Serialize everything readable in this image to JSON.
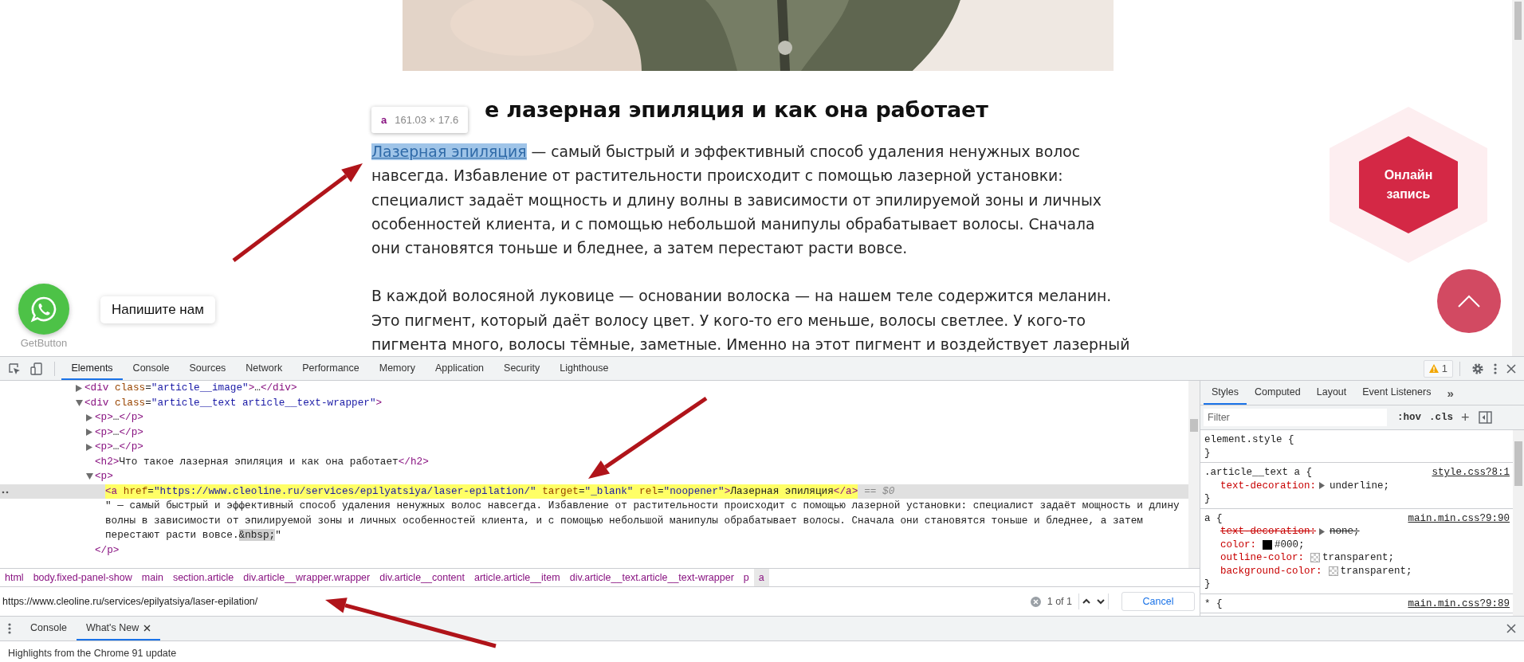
{
  "page": {
    "heading": "е лазерная эпиляция и как она работает",
    "inspect_tooltip": {
      "tag": "a",
      "size": "161.03 × 17.6"
    },
    "paragraphs": [
      {
        "link": "Лазерная эпиляция",
        "link_highlighted": true,
        "lines": [
          " — самый быстрый и эффективный способ удаления ненужных волос",
          "навсегда. Избавление от растительности происходит с помощью лазерной установки:",
          "специалист задаёт мощность и длину волны в зависимости от эпилируемой зоны и личных",
          "особенностей клиента, и с помощью небольшой манипулы обрабатывает волосы. Сначала",
          "они становятся тоньше и бледнее, а затем перестают расти вовсе."
        ]
      },
      {
        "lines": [
          "В каждой волосяной луковице — основании волоска — на нашем теле содержится меланин.",
          "Это пигмент, который даёт волосу цвет. У кого-то его меньше, волосы светлее. У кого-то",
          "пигмента много, волосы тёмные, заметные. Именно на этот пигмент и воздействует лазерный"
        ]
      }
    ],
    "chat_widget": {
      "caption": "GetButton",
      "bubble": "Напишите нам"
    },
    "booking_button": "Онлайн запись"
  },
  "devtools": {
    "tabs": [
      {
        "label": "Elements",
        "selected": true
      },
      {
        "label": "Console",
        "selected": false
      },
      {
        "label": "Sources",
        "selected": false
      },
      {
        "label": "Network",
        "selected": false
      },
      {
        "label": "Performance",
        "selected": false
      },
      {
        "label": "Memory",
        "selected": false
      },
      {
        "label": "Application",
        "selected": false
      },
      {
        "label": "Security",
        "selected": false
      },
      {
        "label": "Lighthouse",
        "selected": false
      }
    ],
    "issues_count": "1",
    "dom_tree": [
      {
        "kind": "collapsed",
        "markup": "<div class=\"article__image\">…</div>",
        "selected": false
      },
      {
        "kind": "expanded",
        "markup": "<div class=\"article__text article__text-wrapper\">",
        "selected": false,
        "children": [
          {
            "kind": "collapsed",
            "markup": "<p>…</p>",
            "selected": false
          },
          {
            "kind": "collapsed",
            "markup": "<p>…</p>",
            "selected": false
          },
          {
            "kind": "collapsed",
            "markup": "<p>…</p>",
            "selected": false
          },
          {
            "kind": "leaf",
            "markup": "<h2>Что такое лазерная эпиляция и как она работает</h2>",
            "selected": false
          },
          {
            "kind": "expanded",
            "markup": "<p>",
            "selected": false,
            "closing": "</p>",
            "children": [
              {
                "kind": "leaf",
                "markup": "<a href=\"https://www.cleoline.ru/services/epilyatsiya/laser-epilation/\" target=\"_blank\" rel=\"noopener\">Лазерная эпиляция</a>",
                "selected": true,
                "reference": "== $0"
              },
              {
                "kind": "text",
                "markup": "\" — самый быстрый и эффективный способ удаления ненужных волос навсегда. Избавление от растительности происходит с помощью лазерной установки: специалист задаёт мощность и длину волны в зависимости от эпилируемой зоны и личных особенностей клиента, и с помощью небольшой манипулы обрабатывает волосы. Сначала они становятся тоньше и бледнее, а затем перестают расти вовсе.&nbsp;\"",
                "selected": false
              }
            ]
          }
        ]
      }
    ],
    "breadcrumbs": [
      {
        "label": "html",
        "selected": false
      },
      {
        "label": "body.fixed-panel-show",
        "selected": false
      },
      {
        "label": "main",
        "selected": false
      },
      {
        "label": "section.article",
        "selected": false
      },
      {
        "label": "div.article__wrapper.wrapper",
        "selected": false
      },
      {
        "label": "div.article__content",
        "selected": false
      },
      {
        "label": "article.article__item",
        "selected": false
      },
      {
        "label": "div.article__text.article__text-wrapper",
        "selected": false
      },
      {
        "label": "p",
        "selected": false
      },
      {
        "label": "a",
        "selected": true
      }
    ],
    "search": {
      "value": "https://www.cleoline.ru/services/epilyatsiya/laser-epilation/",
      "match_count": "1 of 1",
      "cancel": "Cancel"
    },
    "styles": {
      "tabs": [
        {
          "label": "Styles",
          "selected": true
        },
        {
          "label": "Computed",
          "selected": false
        },
        {
          "label": "Layout",
          "selected": false
        },
        {
          "label": "Event Listeners",
          "selected": false
        }
      ],
      "more": "»",
      "filter_placeholder": "Filter",
      "hov": ":hov",
      "cls": ".cls",
      "add": "+",
      "rules": [
        {
          "selector": "element.style {",
          "closing": "}"
        },
        {
          "selector": ".article__text a {",
          "source": "style.css?8:1",
          "closing": "}",
          "declarations": [
            {
              "property": "text-decoration:",
              "value": "underline;",
              "overridden": false,
              "expandable": true
            }
          ]
        },
        {
          "selector": "a {",
          "source": "main.min.css?9:90",
          "closing": "}",
          "declarations": [
            {
              "property": "text-decoration:",
              "value": "none;",
              "overridden": true,
              "expandable": true
            },
            {
              "property": "color:",
              "value": "#000;",
              "overridden": false,
              "expandable": false,
              "swatch": {
                "kind": "solid",
                "color": "#000000"
              }
            },
            {
              "property": "outline-color:",
              "value": "transparent;",
              "overridden": false,
              "expandable": false,
              "swatch": {
                "kind": "checker"
              }
            },
            {
              "property": "background-color:",
              "value": "transparent;",
              "overridden": false,
              "expandable": false,
              "swatch": {
                "kind": "checker"
              }
            }
          ]
        },
        {
          "selector": "* {",
          "source": "main.min.css?9:89"
        }
      ]
    },
    "drawer": {
      "tabs": [
        {
          "label": "Console",
          "selected": false,
          "closable": false
        },
        {
          "label": "What's New",
          "selected": true,
          "closable": true
        }
      ],
      "message": "Highlights from the Chrome 91 update"
    }
  }
}
